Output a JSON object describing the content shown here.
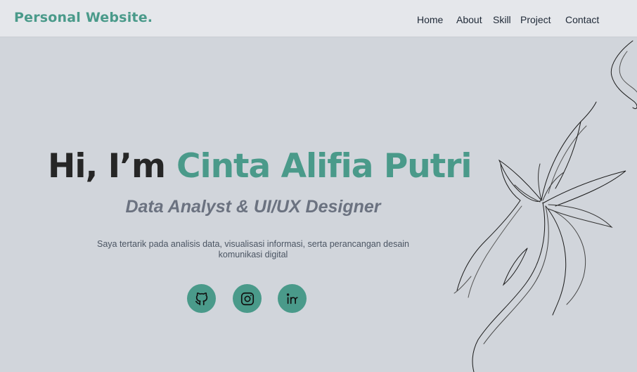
{
  "brand": {
    "name": "Personal Website."
  },
  "nav": {
    "items": [
      {
        "label": "Home"
      },
      {
        "label": "About"
      },
      {
        "label": "Skill"
      },
      {
        "label": "Project"
      },
      {
        "label": "Contact"
      }
    ]
  },
  "hero": {
    "greeting": "Hi, I’m",
    "name": "Cinta Alifia Putri",
    "subtitle": "Data Analyst & UI/UX Designer",
    "description": "Saya tertarik pada analisis data, visualisasi informasi, serta perancangan desain komunikasi digital"
  },
  "social": [
    {
      "icon": "github-icon"
    },
    {
      "icon": "instagram-icon"
    },
    {
      "icon": "linkedin-icon"
    }
  ],
  "colors": {
    "accent": "#4a9a8a",
    "background": "#d1d5db",
    "navbar": "#e5e7eb",
    "heading": "#262626",
    "subtitle": "#6b7280"
  }
}
